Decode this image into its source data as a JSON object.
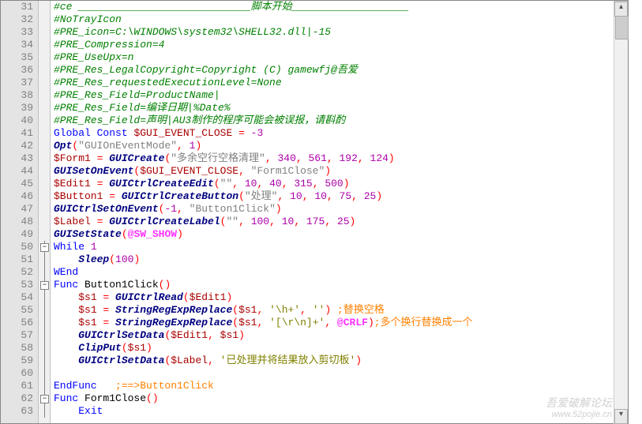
{
  "first_line": 31,
  "last_line": 63,
  "watermark": {
    "text": "吾爱破解论坛",
    "url": "www.52pojie.cn"
  },
  "code": {
    "l31": {
      "comment": "#ce ____________________________脚本开始___________________"
    },
    "l32": {
      "comment": "#NoTrayIcon"
    },
    "l33": {
      "comment": "#PRE_icon=C:\\WINDOWS\\system32\\SHELL32.dll|-15"
    },
    "l34": {
      "comment": "#PRE_Compression=4"
    },
    "l35": {
      "comment": "#PRE_UseUpx=n"
    },
    "l36": {
      "comment": "#PRE_Res_LegalCopyright=Copyright (C) gamewfj@吾爱"
    },
    "l37": {
      "comment": "#PRE_Res_requestedExecutionLevel=None"
    },
    "l38": {
      "comment": "#PRE_Res_Field=ProductName|"
    },
    "l39": {
      "comment": "#PRE_Res_Field=编译日期|%Date%"
    },
    "l40": {
      "comment": "#PRE_Res_Field=声明|AU3制作的程序可能会被误报，请斟酌"
    },
    "l41": {
      "kw1": "Global Const",
      "var": "$GUI_EVENT_CLOSE",
      "eq": " = ",
      "num": "-3"
    },
    "l42": {
      "fn": "Opt",
      "p1": "(",
      "s": "\"GUIOnEventMode\"",
      "c": ", ",
      "n": "1",
      "p2": ")"
    },
    "l43": {
      "var": "$Form1",
      "eq": " = ",
      "fn": "GUICreate",
      "p1": "(",
      "s": "\"多余空行空格清理\"",
      "rest_nums": [
        "340",
        "561",
        "192",
        "124"
      ]
    },
    "l44": {
      "fn": "GUISetOnEvent",
      "p1": "(",
      "var": "$GUI_EVENT_CLOSE",
      "c": ", ",
      "s": "\"Form1Close\"",
      "p2": ")"
    },
    "l45": {
      "var": "$Edit1",
      "eq": " = ",
      "fn": "GUICtrlCreateEdit",
      "p1": "(",
      "s": "\"\"",
      "nums": [
        "10",
        "40",
        "315",
        "500"
      ]
    },
    "l46": {
      "var": "$Button1",
      "eq": " = ",
      "fn": "GUICtrlCreateButton",
      "p1": "(",
      "s": "\"处理\"",
      "nums": [
        "10",
        "10",
        "75",
        "25"
      ]
    },
    "l47": {
      "fn": "GUICtrlSetOnEvent",
      "p1": "(",
      "num": "-1",
      "c": ", ",
      "s": "\"Button1Click\"",
      "p2": ")"
    },
    "l48": {
      "var": "$Label",
      "eq": " = ",
      "fn": "GUICtrlCreateLabel",
      "p1": "(",
      "s": "\"\"",
      "nums": [
        "100",
        "10",
        "175",
        "25"
      ]
    },
    "l49": {
      "fn": "GUISetState",
      "p1": "(",
      "macro": "@SW_SHOW",
      "p2": ")"
    },
    "l50": {
      "kw": "While",
      "n": "1"
    },
    "l51": {
      "fn": "Sleep",
      "p1": "(",
      "n": "100",
      "p2": ")"
    },
    "l52": {
      "kw": "WEnd"
    },
    "l53": {
      "kw": "Func",
      "name": " Button1Click",
      "p1": "(",
      "p2": ")"
    },
    "l54": {
      "var": "$s1",
      "eq": " = ",
      "fn": "GUICtrlRead",
      "p1": "(",
      "arg": "$Edit1",
      "p2": ")"
    },
    "l55": {
      "var": "$s1",
      "eq": " = ",
      "fn": "StringRegExpReplace",
      "p1": "(",
      "a1": "$s1",
      "s1": "'\\h+'",
      "s2": "''",
      "p2": ")",
      "cm": " ;替换空格"
    },
    "l56": {
      "var": "$s1",
      "eq": " = ",
      "fn": "StringRegExpReplace",
      "p1": "(",
      "a1": "$s1",
      "s1": "'[\\r\\n]+'",
      "macro": "@CRLF",
      "p2": ")",
      "cm": ";多个换行替换成一个"
    },
    "l57": {
      "fn": "GUICtrlSetData",
      "p1": "(",
      "a1": "$Edit1",
      "a2": "$s1",
      "p2": ")"
    },
    "l58": {
      "fn": "ClipPut",
      "p1": "(",
      "a1": "$s1",
      "p2": ")"
    },
    "l59": {
      "fn": "GUICtrlSetData",
      "p1": "(",
      "a1": "$Label",
      "s": "'已处理并将结果放入剪切板'",
      "p2": ")"
    },
    "l61": {
      "kw": "EndFunc",
      "cm": "   ;==>Button1Click"
    },
    "l62": {
      "kw": "Func",
      "name": " Form1Close",
      "p1": "(",
      "p2": ")"
    },
    "l63": {
      "kw": "Exit"
    }
  }
}
